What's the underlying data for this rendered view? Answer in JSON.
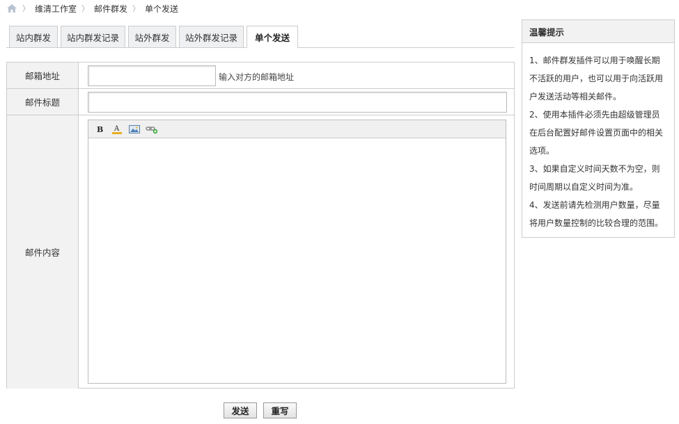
{
  "breadcrumb": {
    "items": [
      "维清工作室",
      "邮件群发",
      "单个发送"
    ]
  },
  "tabs": [
    {
      "label": "站内群发"
    },
    {
      "label": "站内群发记录"
    },
    {
      "label": "站外群发"
    },
    {
      "label": "站外群发记录"
    },
    {
      "label": "单个发送",
      "active": true
    }
  ],
  "form": {
    "email_label": "邮箱地址",
    "email_value": "",
    "email_hint": "输入对方的邮箱地址",
    "subject_label": "邮件标题",
    "subject_value": "",
    "content_label": "邮件内容",
    "toolbar": [
      "bold-icon",
      "font-color-icon",
      "image-icon",
      "link-icon"
    ]
  },
  "buttons": {
    "send": "发送",
    "reset": "重写"
  },
  "tips": {
    "title": "温馨提示",
    "items": [
      "1、邮件群发插件可以用于唤醒长期不活跃的用户，也可以用于向活跃用户发送活动等相关邮件。",
      "2、使用本插件必须先由超级管理员在后台配置好邮件设置页面中的相关选项。",
      "3、如果自定义时间天数不为空，则时间周期以自定义时间为准。",
      "4、发送前请先检测用户数量，尽量将用户数量控制的比较合理的范围。"
    ]
  }
}
